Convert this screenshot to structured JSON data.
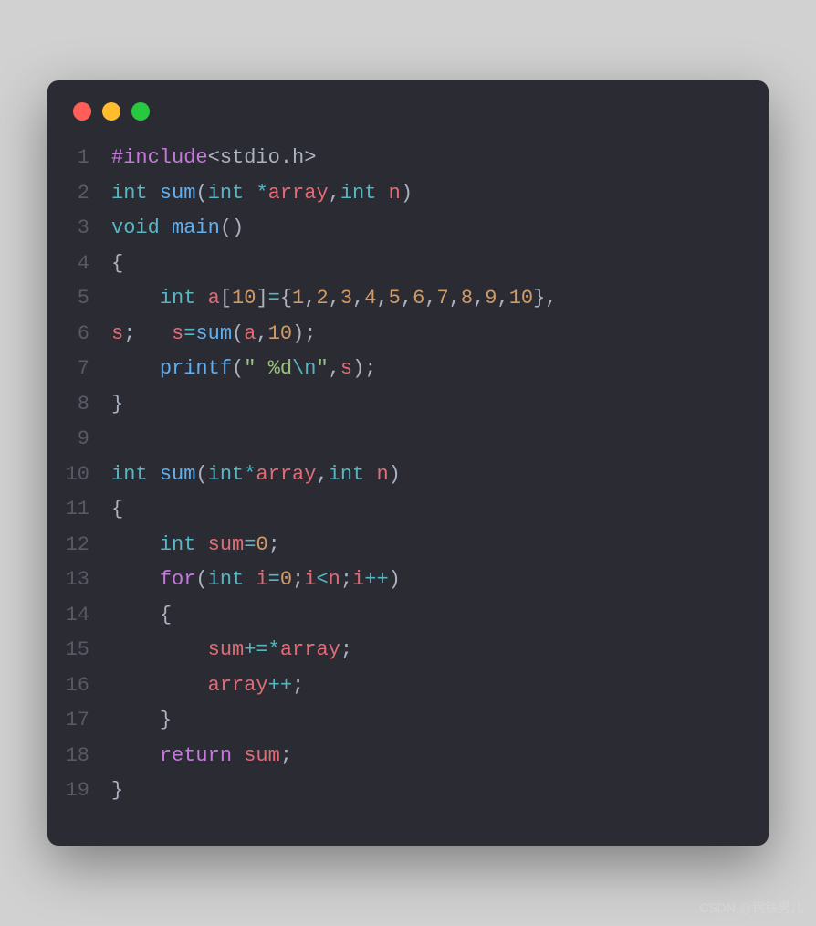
{
  "window": {
    "traffic_light_colors": {
      "close": "#ff5f56",
      "min": "#ffbd2e",
      "max": "#27c93f"
    },
    "background": "#2b2b34"
  },
  "code": {
    "lines": [
      {
        "n": 1,
        "tokens": [
          {
            "c": "pp",
            "t": "#include"
          },
          {
            "c": "pn",
            "t": "<stdio.h>"
          }
        ]
      },
      {
        "n": 2,
        "tokens": [
          {
            "c": "ty",
            "t": "int"
          },
          {
            "c": "pl",
            "t": " "
          },
          {
            "c": "fn",
            "t": "sum"
          },
          {
            "c": "pn",
            "t": "("
          },
          {
            "c": "ty",
            "t": "int"
          },
          {
            "c": "pl",
            "t": " "
          },
          {
            "c": "op",
            "t": "*"
          },
          {
            "c": "id",
            "t": "array"
          },
          {
            "c": "pn",
            "t": ","
          },
          {
            "c": "ty",
            "t": "int"
          },
          {
            "c": "pl",
            "t": " "
          },
          {
            "c": "id",
            "t": "n"
          },
          {
            "c": "pn",
            "t": ")"
          }
        ]
      },
      {
        "n": 3,
        "tokens": [
          {
            "c": "ty",
            "t": "void"
          },
          {
            "c": "pl",
            "t": " "
          },
          {
            "c": "fn",
            "t": "main"
          },
          {
            "c": "pn",
            "t": "()"
          }
        ]
      },
      {
        "n": 4,
        "tokens": [
          {
            "c": "pn",
            "t": "{"
          }
        ]
      },
      {
        "n": 5,
        "tokens": [
          {
            "c": "pl",
            "t": "    "
          },
          {
            "c": "ty",
            "t": "int"
          },
          {
            "c": "pl",
            "t": " "
          },
          {
            "c": "id",
            "t": "a"
          },
          {
            "c": "pn",
            "t": "["
          },
          {
            "c": "num",
            "t": "10"
          },
          {
            "c": "pn",
            "t": "]"
          },
          {
            "c": "op",
            "t": "="
          },
          {
            "c": "pn",
            "t": "{"
          },
          {
            "c": "num",
            "t": "1"
          },
          {
            "c": "pn",
            "t": ","
          },
          {
            "c": "num",
            "t": "2"
          },
          {
            "c": "pn",
            "t": ","
          },
          {
            "c": "num",
            "t": "3"
          },
          {
            "c": "pn",
            "t": ","
          },
          {
            "c": "num",
            "t": "4"
          },
          {
            "c": "pn",
            "t": ","
          },
          {
            "c": "num",
            "t": "5"
          },
          {
            "c": "pn",
            "t": ","
          },
          {
            "c": "num",
            "t": "6"
          },
          {
            "c": "pn",
            "t": ","
          },
          {
            "c": "num",
            "t": "7"
          },
          {
            "c": "pn",
            "t": ","
          },
          {
            "c": "num",
            "t": "8"
          },
          {
            "c": "pn",
            "t": ","
          },
          {
            "c": "num",
            "t": "9"
          },
          {
            "c": "pn",
            "t": ","
          },
          {
            "c": "num",
            "t": "10"
          },
          {
            "c": "pn",
            "t": "},"
          }
        ]
      },
      {
        "n": 6,
        "tokens": [
          {
            "c": "id",
            "t": "s"
          },
          {
            "c": "pn",
            "t": ";"
          },
          {
            "c": "pl",
            "t": "   "
          },
          {
            "c": "id",
            "t": "s"
          },
          {
            "c": "op",
            "t": "="
          },
          {
            "c": "fn",
            "t": "sum"
          },
          {
            "c": "pn",
            "t": "("
          },
          {
            "c": "id",
            "t": "a"
          },
          {
            "c": "pn",
            "t": ","
          },
          {
            "c": "num",
            "t": "10"
          },
          {
            "c": "pn",
            "t": ");"
          }
        ]
      },
      {
        "n": 7,
        "tokens": [
          {
            "c": "pl",
            "t": "    "
          },
          {
            "c": "fn",
            "t": "printf"
          },
          {
            "c": "pn",
            "t": "("
          },
          {
            "c": "str",
            "t": "\" %d"
          },
          {
            "c": "esc",
            "t": "\\n"
          },
          {
            "c": "str",
            "t": "\""
          },
          {
            "c": "pn",
            "t": ","
          },
          {
            "c": "id",
            "t": "s"
          },
          {
            "c": "pn",
            "t": ");"
          }
        ]
      },
      {
        "n": 8,
        "tokens": [
          {
            "c": "pn",
            "t": "}"
          }
        ]
      },
      {
        "n": 9,
        "tokens": []
      },
      {
        "n": 10,
        "tokens": [
          {
            "c": "ty",
            "t": "int"
          },
          {
            "c": "pl",
            "t": " "
          },
          {
            "c": "fn",
            "t": "sum"
          },
          {
            "c": "pn",
            "t": "("
          },
          {
            "c": "ty",
            "t": "int"
          },
          {
            "c": "op",
            "t": "*"
          },
          {
            "c": "id",
            "t": "array"
          },
          {
            "c": "pn",
            "t": ","
          },
          {
            "c": "ty",
            "t": "int"
          },
          {
            "c": "pl",
            "t": " "
          },
          {
            "c": "id",
            "t": "n"
          },
          {
            "c": "pn",
            "t": ")"
          }
        ]
      },
      {
        "n": 11,
        "tokens": [
          {
            "c": "pn",
            "t": "{"
          }
        ]
      },
      {
        "n": 12,
        "tokens": [
          {
            "c": "pl",
            "t": "    "
          },
          {
            "c": "ty",
            "t": "int"
          },
          {
            "c": "pl",
            "t": " "
          },
          {
            "c": "id",
            "t": "sum"
          },
          {
            "c": "op",
            "t": "="
          },
          {
            "c": "num",
            "t": "0"
          },
          {
            "c": "pn",
            "t": ";"
          }
        ]
      },
      {
        "n": 13,
        "tokens": [
          {
            "c": "pl",
            "t": "    "
          },
          {
            "c": "kw",
            "t": "for"
          },
          {
            "c": "pn",
            "t": "("
          },
          {
            "c": "ty",
            "t": "int"
          },
          {
            "c": "pl",
            "t": " "
          },
          {
            "c": "id",
            "t": "i"
          },
          {
            "c": "op",
            "t": "="
          },
          {
            "c": "num",
            "t": "0"
          },
          {
            "c": "pn",
            "t": ";"
          },
          {
            "c": "id",
            "t": "i"
          },
          {
            "c": "op",
            "t": "<"
          },
          {
            "c": "id",
            "t": "n"
          },
          {
            "c": "pn",
            "t": ";"
          },
          {
            "c": "id",
            "t": "i"
          },
          {
            "c": "op",
            "t": "++"
          },
          {
            "c": "pn",
            "t": ")"
          }
        ]
      },
      {
        "n": 14,
        "tokens": [
          {
            "c": "pl",
            "t": "    "
          },
          {
            "c": "pn",
            "t": "{"
          }
        ]
      },
      {
        "n": 15,
        "tokens": [
          {
            "c": "pl",
            "t": "        "
          },
          {
            "c": "id",
            "t": "sum"
          },
          {
            "c": "op",
            "t": "+=*"
          },
          {
            "c": "id",
            "t": "array"
          },
          {
            "c": "pn",
            "t": ";"
          }
        ]
      },
      {
        "n": 16,
        "tokens": [
          {
            "c": "pl",
            "t": "        "
          },
          {
            "c": "id",
            "t": "array"
          },
          {
            "c": "op",
            "t": "++"
          },
          {
            "c": "pn",
            "t": ";"
          }
        ]
      },
      {
        "n": 17,
        "tokens": [
          {
            "c": "pl",
            "t": "    "
          },
          {
            "c": "pn",
            "t": "}"
          }
        ]
      },
      {
        "n": 18,
        "tokens": [
          {
            "c": "pl",
            "t": "    "
          },
          {
            "c": "kw",
            "t": "return"
          },
          {
            "c": "pl",
            "t": " "
          },
          {
            "c": "id",
            "t": "sum"
          },
          {
            "c": "pn",
            "t": ";"
          }
        ]
      },
      {
        "n": 19,
        "tokens": [
          {
            "c": "pn",
            "t": "}"
          }
        ]
      }
    ]
  },
  "watermark": "CSDN @钢铁男儿"
}
